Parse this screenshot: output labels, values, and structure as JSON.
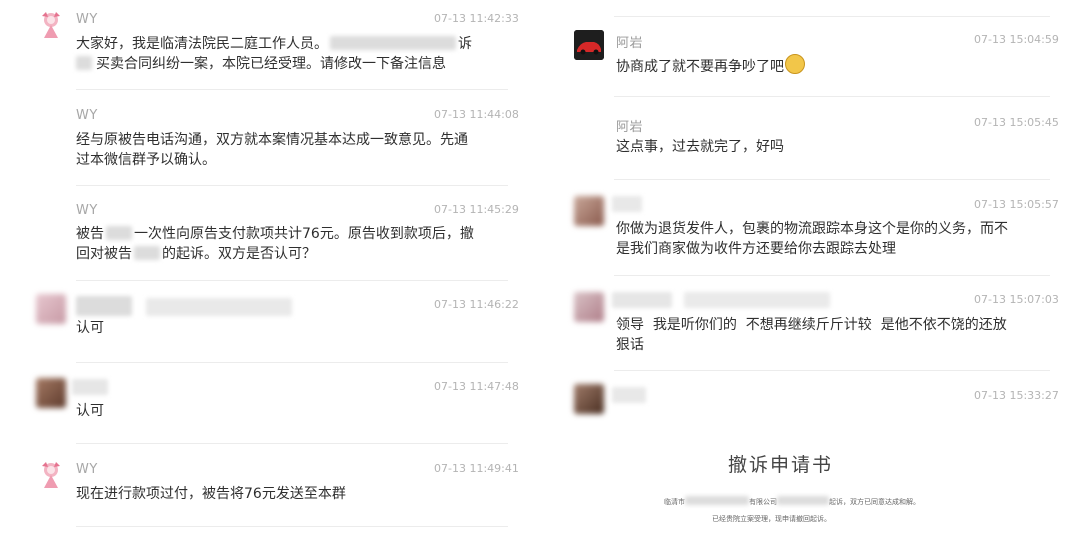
{
  "left_messages": [
    {
      "name": "WY",
      "time": "07-13 11:42:33",
      "text": [
        "大家好，我是临清法院民二庭工作人员。",
        "诉",
        "买卖合同纠纷一案，本院已经受理。请修改一下备注信息"
      ]
    },
    {
      "name": "WY",
      "time": "07-13 11:44:08",
      "text": [
        "经与原被告电话沟通，双方就本案情况基本达成一致意见。先通",
        "过本微信群予以确认。"
      ]
    },
    {
      "name": "WY",
      "time": "07-13 11:45:29",
      "text": [
        "被告",
        "一次性向原告支付款项共计76元。原告收到款项后，撤",
        "回对被告",
        "的起诉。双方是否认可？"
      ]
    },
    {
      "name": "",
      "time": "07-13 11:46:22",
      "text": [
        "认可"
      ]
    },
    {
      "name": "",
      "time": "07-13 11:47:48",
      "text": [
        "认可"
      ]
    },
    {
      "name": "WY",
      "time": "07-13 11:49:41",
      "text": [
        "现在进行款项过付，被告将76元发送至本群"
      ]
    }
  ],
  "right_messages": [
    {
      "name": "阿岩",
      "time": "07-13 15:04:59",
      "text": [
        "协商成了就不要再争吵了吧"
      ]
    },
    {
      "name": "阿岩",
      "time": "07-13 15:05:45",
      "text": [
        "这点事，过去就完了，好吗"
      ]
    },
    {
      "name": "",
      "time": "07-13 15:05:57",
      "text": [
        "你做为退货发件人，包裹的物流跟踪本身这个是你的义务，而不",
        "是我们商家做为收件方还要给你去跟踪去处理"
      ]
    },
    {
      "name": "",
      "time": "07-13 15:07:03",
      "text": [
        "领导  我是听你们的  不想再继续斤斤计较  是他不依不饶的还放",
        "狠话"
      ]
    },
    {
      "name": "",
      "time": "07-13 15:33:27",
      "text": []
    }
  ],
  "document": {
    "title": "撤诉申请书",
    "line1a": "临清市",
    "line1b": "有限公司",
    "line1c": "起诉，双方已同意达成和解。",
    "line2": "已经贵院立案受理，现申请撤回起诉。"
  }
}
